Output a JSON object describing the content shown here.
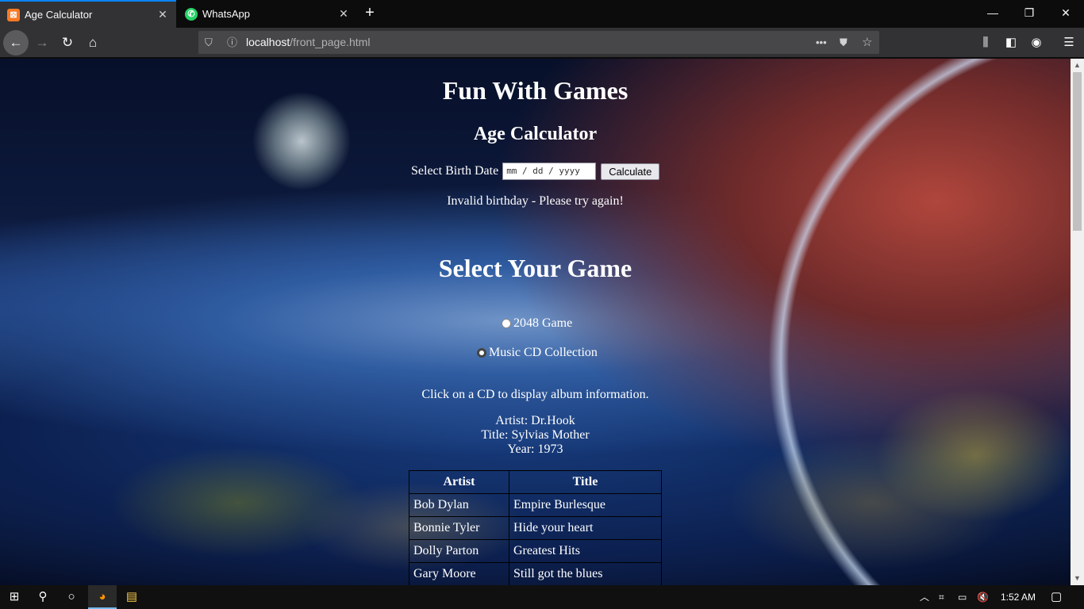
{
  "browser": {
    "tabs": [
      {
        "title": "Age Calculator",
        "icon": "xampp-icon",
        "active": true
      },
      {
        "title": "WhatsApp",
        "icon": "whatsapp-icon",
        "active": false
      }
    ],
    "url_host": "localhost",
    "url_path": "/front_page.html"
  },
  "page": {
    "site_title": "Fun With Games",
    "age_title": "Age Calculator",
    "birth_label": "Select Birth Date",
    "date_placeholder": "mm / dd / yyyy",
    "calculate_label": "Calculate",
    "message": "Invalid birthday - Please try again!",
    "game_title": "Select Your Game",
    "games": [
      {
        "label": "2048 Game",
        "selected": false
      },
      {
        "label": "Music CD Collection",
        "selected": true
      }
    ],
    "instruction": "Click on a CD to display album information.",
    "album": {
      "artist": "Artist: Dr.Hook",
      "title": "Title: Sylvias Mother",
      "year": "Year: 1973"
    },
    "table": {
      "headers": [
        "Artist",
        "Title"
      ],
      "rows": [
        [
          "Bob Dylan",
          "Empire Burlesque"
        ],
        [
          "Bonnie Tyler",
          "Hide your heart"
        ],
        [
          "Dolly Parton",
          "Greatest Hits"
        ],
        [
          "Gary Moore",
          "Still got the blues"
        ]
      ]
    }
  },
  "taskbar": {
    "time": "1:52 AM"
  }
}
